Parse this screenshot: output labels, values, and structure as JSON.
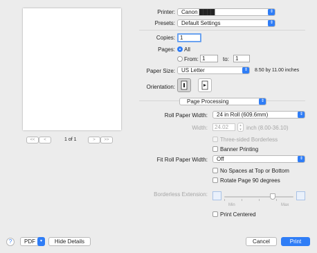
{
  "preview": {
    "page_indicator": "1 of 1",
    "first": "<<",
    "prev": "<",
    "next": ">",
    "last": ">>"
  },
  "printer": {
    "label": "Printer:",
    "value": "Canon ████"
  },
  "presets": {
    "label": "Presets:",
    "value": "Default Settings"
  },
  "copies": {
    "label": "Copies:",
    "value": "1"
  },
  "pages": {
    "label": "Pages:",
    "all": "All",
    "from_label": "From:",
    "from_value": "1",
    "to_label": "to:",
    "to_value": "1"
  },
  "paper_size": {
    "label": "Paper Size:",
    "value": "US Letter",
    "dims": "8.50 by 11.00 inches"
  },
  "orientation": {
    "label": "Orientation:"
  },
  "section": {
    "value": "Page Processing"
  },
  "roll_paper_width": {
    "label": "Roll Paper Width:",
    "value": "24 in Roll (609.6mm)"
  },
  "width": {
    "label": "Width:",
    "value": "24.02",
    "unit": "inch (8.00-36.10)"
  },
  "three_sided": {
    "label": "Three-sided Borderless"
  },
  "banner": {
    "label": "Banner Printing"
  },
  "fit_roll": {
    "label": "Fit Roll Paper Width:",
    "value": "Off"
  },
  "no_spaces": {
    "label": "No Spaces at Top or Bottom"
  },
  "rotate": {
    "label": "Rotate Page 90 degrees"
  },
  "borderless_ext": {
    "label": "Borderless Extension:",
    "min": "Min",
    "max": "Max",
    "level": 0.7
  },
  "print_centered": {
    "label": "Print Centered"
  },
  "footer": {
    "help": "?",
    "pdf": "PDF",
    "hide_details": "Hide Details",
    "cancel": "Cancel",
    "print": "Print"
  },
  "colors": {
    "accent": "#2f7df6"
  }
}
